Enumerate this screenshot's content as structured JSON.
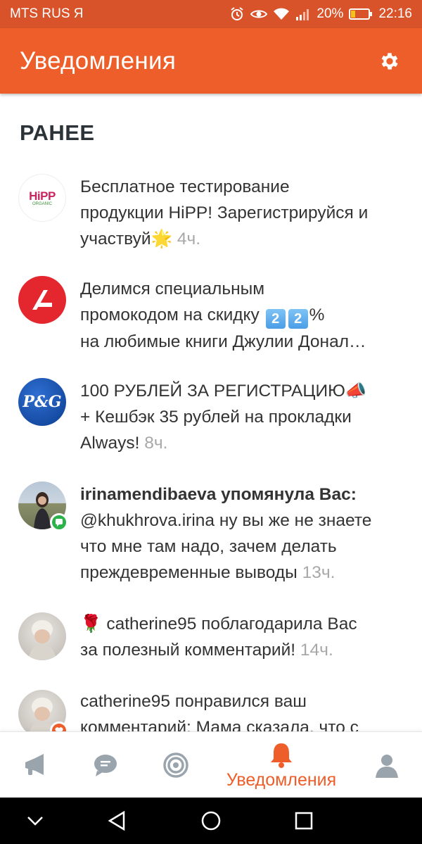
{
  "status_bar": {
    "carrier": "MTS RUS Я",
    "battery": "20%",
    "time": "22:16"
  },
  "app_bar": {
    "title": "Уведомления",
    "settings_icon": "gear-icon"
  },
  "section_title": "РАНЕЕ",
  "notifications": [
    {
      "avatar": "HiPP ORGANIC",
      "logo_word": "HiPP",
      "logo_sub": "ORGANIC",
      "line1": "Бесплатное тестирование",
      "line2": "продукции HiPP! Зарегистрируйся и",
      "line3": "участвуй",
      "emoji": "🌟",
      "time": "4ч."
    },
    {
      "avatar": "red-circle-logo",
      "line1": "Делимся специальным",
      "line2_pre": "промокодом на скидку",
      "digit1": "2",
      "digit2": "2",
      "line2_post": "%",
      "line3": "на любимые книги Джулии Донал…"
    },
    {
      "avatar": "P&G",
      "line1": "100 РУБЛЕЙ ЗА РЕГИСТРАЦИЮ",
      "emoji": "📣",
      "line2": "+ Кешбэк 35 рублей на прокладки",
      "line3": "Always!",
      "time": "8ч."
    },
    {
      "avatar": "user-photo",
      "badge": "comment",
      "user": "irinamendibaeva",
      "action": " упомянула Вас:",
      "line2": "@khukhrova.irina ну вы же не знаете",
      "line3": "что мне там надо, зачем делать",
      "line4": "преждевременные выводы",
      "time": "13ч."
    },
    {
      "avatar": "baby-photo",
      "emoji": "🌹",
      "line1": " catherine95 поблагодарила Вас",
      "line2": "за полезный комментарий!",
      "time": "14ч."
    },
    {
      "avatar": "baby-photo",
      "badge": "like",
      "line1": "catherine95 понравился ваш",
      "line2": "комментарий: Мама сказала, что с"
    }
  ],
  "bottom_nav": {
    "items": [
      "megaphone-icon",
      "chat-icon",
      "target-icon",
      "bell-icon",
      "profile-icon"
    ],
    "active_label": "Уведомления"
  },
  "colors": {
    "accent": "#ee5e2a",
    "status_bar": "#d8532a",
    "time_text": "#a8a8a8"
  }
}
